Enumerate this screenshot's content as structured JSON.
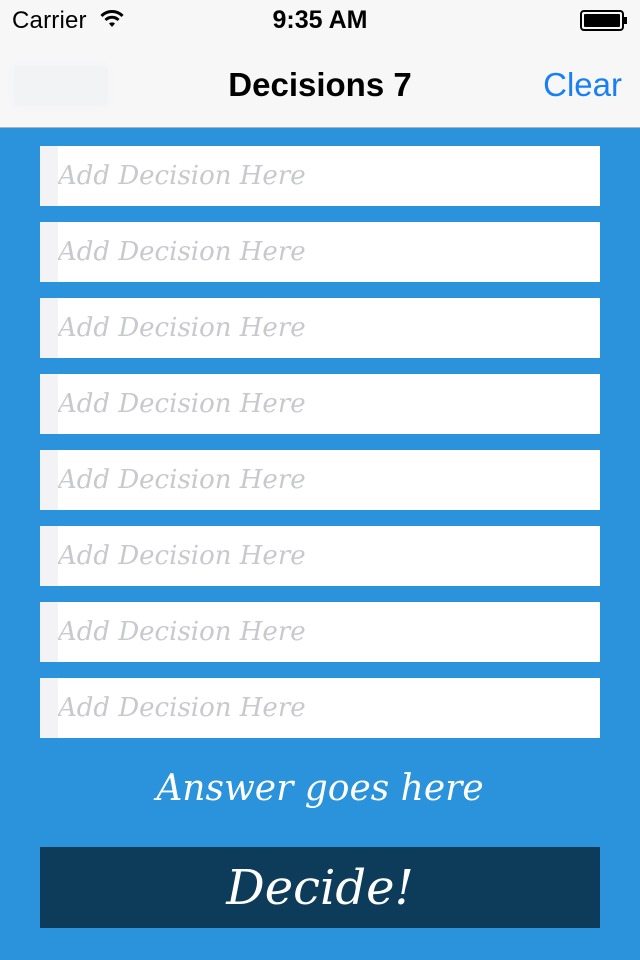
{
  "status_bar": {
    "carrier": "Carrier",
    "time": "9:35 AM",
    "wifi_icon": "wifi-icon",
    "battery_icon": "battery-icon"
  },
  "nav": {
    "title": "Decisions 7",
    "clear_label": "Clear"
  },
  "decisions": [
    {
      "placeholder": "Add Decision Here",
      "value": ""
    },
    {
      "placeholder": "Add Decision Here",
      "value": ""
    },
    {
      "placeholder": "Add Decision Here",
      "value": ""
    },
    {
      "placeholder": "Add Decision Here",
      "value": ""
    },
    {
      "placeholder": "Add Decision Here",
      "value": ""
    },
    {
      "placeholder": "Add Decision Here",
      "value": ""
    },
    {
      "placeholder": "Add Decision Here",
      "value": ""
    },
    {
      "placeholder": "Add Decision Here",
      "value": ""
    }
  ],
  "answer": "Answer goes here",
  "decide_label": "Decide!",
  "colors": {
    "background": "#2a93dc",
    "button": "#0d3b5a",
    "accent": "#1a7ff5",
    "placeholder": "#c8c9cf"
  }
}
